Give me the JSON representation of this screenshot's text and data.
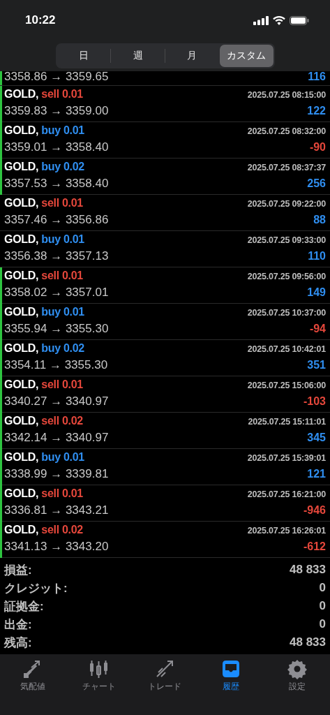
{
  "status_bar": {
    "time": "10:22"
  },
  "period_tabs": [
    {
      "label": "日",
      "selected": false
    },
    {
      "label": "週",
      "selected": false
    },
    {
      "label": "月",
      "selected": false
    },
    {
      "label": "カスタム",
      "selected": true
    }
  ],
  "partial_row": {
    "prices": "3358.86 → 3359.65",
    "profit": "116",
    "loss": false,
    "highlighted": true
  },
  "deals": [
    {
      "symbol": "GOLD,",
      "sell": true,
      "order": "sell 0.01",
      "time": "2025.07.25 08:15:00",
      "prices": "3359.83 → 3359.00",
      "profit": "122",
      "loss": false,
      "highlighted": true
    },
    {
      "symbol": "GOLD,",
      "sell": false,
      "order": "buy 0.01",
      "time": "2025.07.25 08:32:00",
      "prices": "3359.01 → 3358.40",
      "profit": "-90",
      "loss": true,
      "highlighted": true
    },
    {
      "symbol": "GOLD,",
      "sell": false,
      "order": "buy 0.02",
      "time": "2025.07.25 08:37:37",
      "prices": "3357.53 → 3358.40",
      "profit": "256",
      "loss": false,
      "highlighted": true
    },
    {
      "symbol": "GOLD,",
      "sell": true,
      "order": "sell 0.01",
      "time": "2025.07.25 09:22:00",
      "prices": "3357.46 → 3356.86",
      "profit": "88",
      "loss": false,
      "highlighted": false
    },
    {
      "symbol": "GOLD,",
      "sell": false,
      "order": "buy 0.01",
      "time": "2025.07.25 09:33:00",
      "prices": "3356.38 → 3357.13",
      "profit": "110",
      "loss": false,
      "highlighted": false
    },
    {
      "symbol": "GOLD,",
      "sell": true,
      "order": "sell 0.01",
      "time": "2025.07.25 09:56:00",
      "prices": "3358.02 → 3357.01",
      "profit": "149",
      "loss": false,
      "highlighted": true
    },
    {
      "symbol": "GOLD,",
      "sell": false,
      "order": "buy 0.01",
      "time": "2025.07.25 10:37:00",
      "prices": "3355.94 → 3355.30",
      "profit": "-94",
      "loss": true,
      "highlighted": true
    },
    {
      "symbol": "GOLD,",
      "sell": false,
      "order": "buy 0.02",
      "time": "2025.07.25 10:42:01",
      "prices": "3354.11 → 3355.30",
      "profit": "351",
      "loss": false,
      "highlighted": true
    },
    {
      "symbol": "GOLD,",
      "sell": true,
      "order": "sell 0.01",
      "time": "2025.07.25 15:06:00",
      "prices": "3340.27 → 3340.97",
      "profit": "-103",
      "loss": true,
      "highlighted": true
    },
    {
      "symbol": "GOLD,",
      "sell": true,
      "order": "sell 0.02",
      "time": "2025.07.25 15:11:01",
      "prices": "3342.14 → 3340.97",
      "profit": "345",
      "loss": false,
      "highlighted": true
    },
    {
      "symbol": "GOLD,",
      "sell": false,
      "order": "buy 0.01",
      "time": "2025.07.25 15:39:01",
      "prices": "3338.99 → 3339.81",
      "profit": "121",
      "loss": false,
      "highlighted": true
    },
    {
      "symbol": "GOLD,",
      "sell": true,
      "order": "sell 0.01",
      "time": "2025.07.25 16:21:00",
      "prices": "3336.81 → 3343.21",
      "profit": "-946",
      "loss": true,
      "highlighted": true
    },
    {
      "symbol": "GOLD,",
      "sell": true,
      "order": "sell 0.02",
      "time": "2025.07.25 16:26:01",
      "prices": "3341.13 → 3343.20",
      "profit": "-612",
      "loss": true,
      "highlighted": true
    }
  ],
  "summary": [
    {
      "label": "損益:",
      "value": "48 833"
    },
    {
      "label": "クレジット:",
      "value": "0"
    },
    {
      "label": "証拠金:",
      "value": "0"
    },
    {
      "label": "出金:",
      "value": "0"
    },
    {
      "label": "残高:",
      "value": "48 833"
    }
  ],
  "tab_bar": [
    {
      "kind": "quotes",
      "label": "気配値",
      "selected": false
    },
    {
      "kind": "chart",
      "label": "チャート",
      "selected": false
    },
    {
      "kind": "trade",
      "label": "トレード",
      "selected": false
    },
    {
      "kind": "history",
      "label": "履歴",
      "selected": true
    },
    {
      "kind": "settings",
      "label": "設定",
      "selected": false
    }
  ]
}
